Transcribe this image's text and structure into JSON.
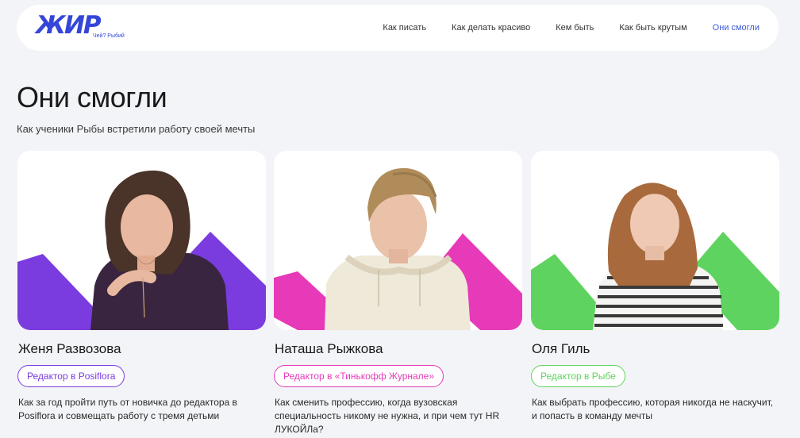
{
  "header": {
    "logo": {
      "word": "ЖИР",
      "tagline": "Чей? Рыбий"
    },
    "nav": [
      {
        "label": "Как писать",
        "active": false
      },
      {
        "label": "Как делать красиво",
        "active": false
      },
      {
        "label": "Кем быть",
        "active": false
      },
      {
        "label": "Как быть крутым",
        "active": false
      },
      {
        "label": "Они смогли",
        "active": true
      }
    ]
  },
  "page": {
    "title": "Они смогли",
    "subtitle": "Как ученики Рыбы встретили работу своей мечты"
  },
  "cards": [
    {
      "name": "Женя Развозова",
      "badge": "Редактор в Posiflora",
      "description": "Как за год пройти путь от новичка до редактора в Posiflora и совмещать работу с тремя детьми",
      "accent": "#7a3bdf"
    },
    {
      "name": "Наташа Рыжкова",
      "badge": "Редактор в «Тинькофф Журнале»",
      "description": "Как сменить профессию, когда вузовская специальность никому не нужна, и при чем тут HR ЛУКОЙЛа?",
      "accent": "#e63ab8"
    },
    {
      "name": "Оля Гиль",
      "badge": "Редактор в Рыбе",
      "description": "Как выбрать профессию, которая никогда не наскучит, и попасть в команду мечты",
      "accent": "#5fd35f"
    }
  ]
}
